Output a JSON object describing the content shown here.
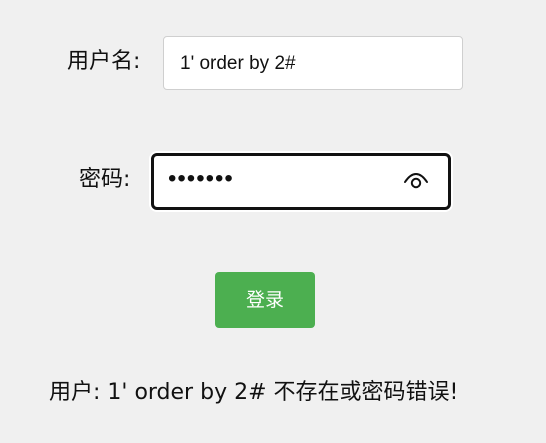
{
  "form": {
    "username_label": "用户名:",
    "username_value": "1' order by 2#",
    "password_label": "密码:",
    "password_mask": "•••••••",
    "show_password_icon": "eye-icon",
    "login_label": "登录"
  },
  "message": {
    "text": "用户: 1' order by 2# 不存在或密码错误!"
  },
  "colors": {
    "background": "#f0f0f0",
    "button": "#4caf50",
    "text": "#111111"
  }
}
